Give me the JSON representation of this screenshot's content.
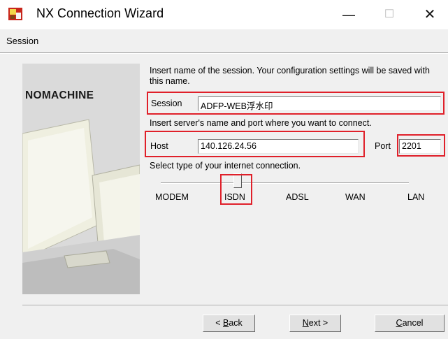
{
  "window": {
    "title": "NX Connection Wizard",
    "minimize_glyph": "—",
    "maximize_glyph": "☐",
    "close_glyph": "✕"
  },
  "header": {
    "title": "Session"
  },
  "brand": {
    "logo_text": "NOMACHINE"
  },
  "form": {
    "intro_text": "Insert name of the session. Your configuration settings will be saved with this name.",
    "session_label": "Session",
    "session_value": "ADFP-WEB浮水印",
    "server_instruction": "Insert server's name and port where you want to connect.",
    "host_label": "Host",
    "host_value": "140.126.24.56",
    "port_label": "Port",
    "port_value": "2201",
    "connection_instruction": "Select type of your internet connection.",
    "connection_types": [
      "MODEM",
      "ISDN",
      "ADSL",
      "WAN",
      "LAN"
    ],
    "selected_connection": "ISDN"
  },
  "buttons": {
    "back_prefix": "< ",
    "back_key": "B",
    "back_rest": "ack",
    "next_key": "N",
    "next_rest": "ext >",
    "cancel_key": "C",
    "cancel_rest": "ancel"
  },
  "colors": {
    "highlight": "#e0202a",
    "dialog_bg": "#f0f0f0"
  },
  "icons": {
    "app": "nx-app-icon"
  }
}
